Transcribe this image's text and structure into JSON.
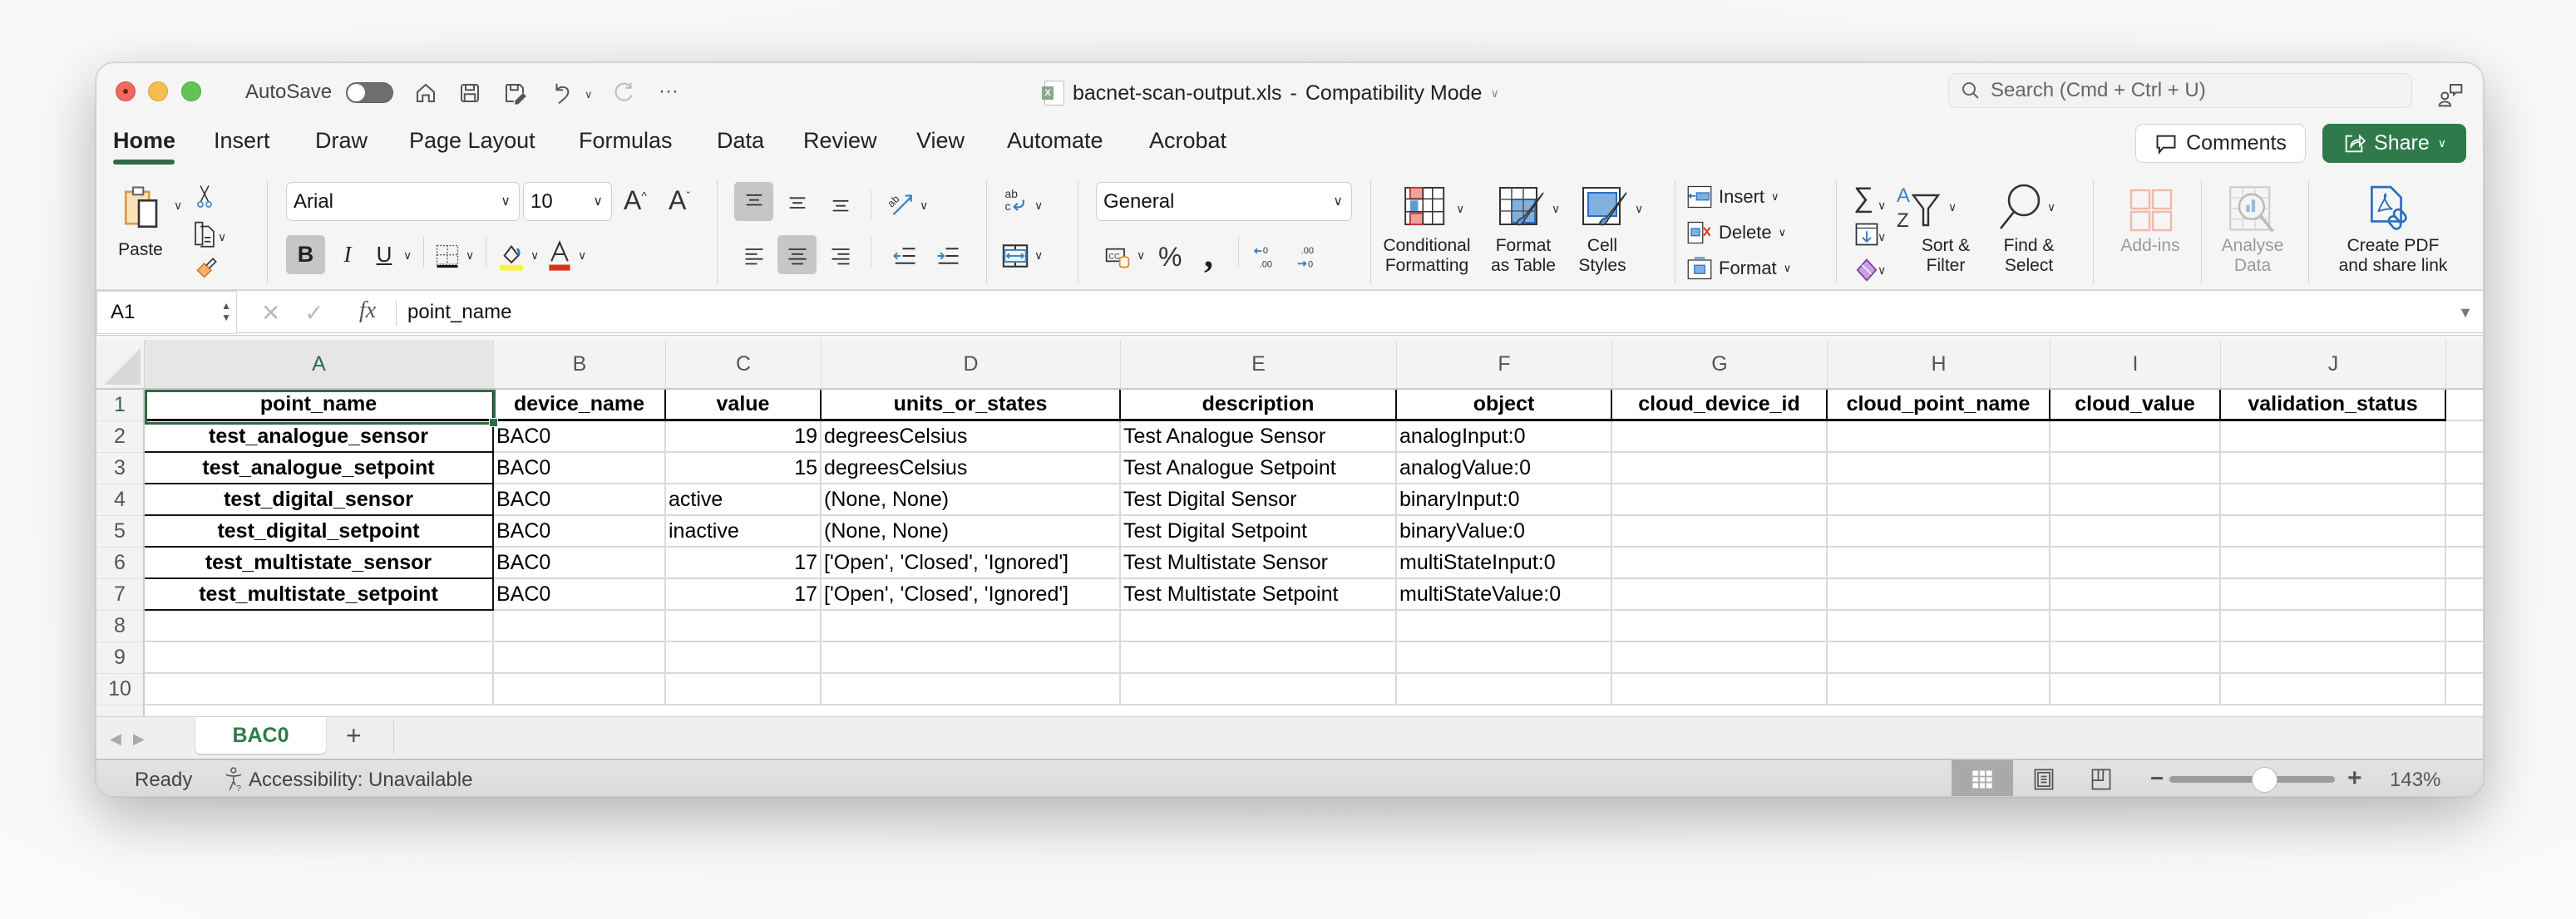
{
  "window": {
    "title": "bacnet-scan-output.xls",
    "title_separator": "-",
    "mode": "Compatibility Mode",
    "autosave_label": "AutoSave",
    "autosave_on": false
  },
  "quick_access": {
    "icons": [
      "home-icon",
      "save-icon",
      "save-as-icon",
      "undo-icon",
      "undo-dropdown-icon",
      "redo-icon",
      "more-icon"
    ],
    "more_label": "···"
  },
  "search": {
    "placeholder": "Search (Cmd + Ctrl + U)"
  },
  "menu_tabs": [
    {
      "label": "Home",
      "active": true
    },
    {
      "label": "Insert"
    },
    {
      "label": "Draw"
    },
    {
      "label": "Page Layout"
    },
    {
      "label": "Formulas"
    },
    {
      "label": "Data"
    },
    {
      "label": "Review"
    },
    {
      "label": "View"
    },
    {
      "label": "Automate"
    },
    {
      "label": "Acrobat"
    }
  ],
  "header_buttons": {
    "comments": "Comments",
    "share": "Share"
  },
  "ribbon": {
    "paste_label": "Paste",
    "font_name": "Arial",
    "font_size": "10",
    "bold": "B",
    "italic": "I",
    "underline": "U",
    "number_format": "General",
    "percent": "%",
    "comma": ",",
    "conditional_formatting": [
      "Conditional",
      "Formatting"
    ],
    "format_as_table": [
      "Format",
      "as Table"
    ],
    "cell_styles": [
      "Cell",
      "Styles"
    ],
    "insert": "Insert",
    "delete": "Delete",
    "format": "Format",
    "sort_filter": [
      "Sort &",
      "Filter"
    ],
    "find_select": [
      "Find &",
      "Select"
    ],
    "add_ins": "Add-ins",
    "analyse_data": [
      "Analyse",
      "Data"
    ],
    "create_pdf": [
      "Create PDF",
      "and share link"
    ],
    "colors": {
      "highlight": "#f5f542",
      "font_color": "#e0301e",
      "accent": "#2f6b45",
      "share": "#2f7a4a"
    }
  },
  "formula_bar": {
    "name_box": "A1",
    "fx": "fx",
    "cancel": "✕",
    "enter": "✓",
    "content": "point_name"
  },
  "sheet": {
    "selected_cell": "A1",
    "columns": [
      "A",
      "B",
      "C",
      "D",
      "E",
      "F",
      "G",
      "H",
      "I",
      "J"
    ],
    "row_numbers": [
      "1",
      "2",
      "3",
      "4",
      "5",
      "6",
      "7",
      "8",
      "9",
      "10"
    ],
    "header_row": [
      "point_name",
      "device_name",
      "value",
      "units_or_states",
      "description",
      "object",
      "cloud_device_id",
      "cloud_point_name",
      "cloud_value",
      "validation_status"
    ],
    "rows": [
      [
        "test_analogue_sensor",
        "BAC0",
        "19",
        "degreesCelsius",
        "Test Analogue Sensor",
        "analogInput:0",
        "",
        "",
        "",
        ""
      ],
      [
        "test_analogue_setpoint",
        "BAC0",
        "15",
        "degreesCelsius",
        "Test Analogue Setpoint",
        "analogValue:0",
        "",
        "",
        "",
        ""
      ],
      [
        "test_digital_sensor",
        "BAC0",
        "active",
        "(None, None)",
        "Test Digital Sensor",
        "binaryInput:0",
        "",
        "",
        "",
        ""
      ],
      [
        "test_digital_setpoint",
        "BAC0",
        "inactive",
        "(None, None)",
        "Test Digital Setpoint",
        "binaryValue:0",
        "",
        "",
        "",
        ""
      ],
      [
        "test_multistate_sensor",
        "BAC0",
        "17",
        "['Open', 'Closed', 'Ignored']",
        "Test Multistate Sensor",
        "multiStateInput:0",
        "",
        "",
        "",
        ""
      ],
      [
        "test_multistate_setpoint",
        "BAC0",
        "17",
        "['Open', 'Closed', 'Ignored']",
        "Test Multistate Setpoint",
        "multiStateValue:0",
        "",
        "",
        "",
        ""
      ]
    ]
  },
  "sheet_tabs": {
    "tabs": [
      {
        "label": "BAC0",
        "active": true
      }
    ],
    "add_label": "+"
  },
  "status_bar": {
    "ready": "Ready",
    "accessibility": "Accessibility: Unavailable",
    "zoom_percent": "143%",
    "zoom_value": 143,
    "zoom_minus": "−",
    "zoom_plus": "+"
  }
}
